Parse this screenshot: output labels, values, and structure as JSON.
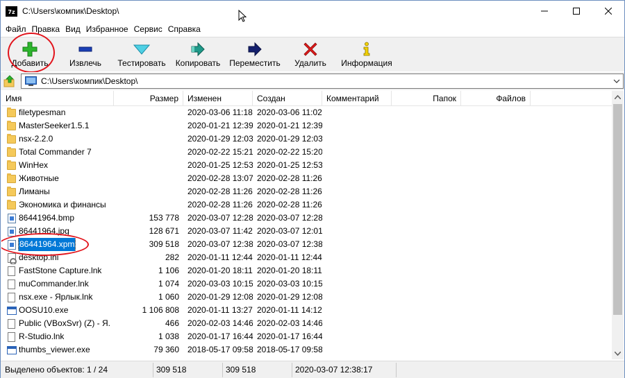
{
  "window": {
    "icon_text": "7z",
    "title": "C:\\Users\\компик\\Desktop\\"
  },
  "menu": [
    "Файл",
    "Правка",
    "Вид",
    "Избранное",
    "Сервис",
    "Справка"
  ],
  "toolbar": {
    "add": "Добавить",
    "extract": "Извлечь",
    "test": "Тестировать",
    "copy": "Копировать",
    "move": "Переместить",
    "delete": "Удалить",
    "info": "Информация"
  },
  "address": {
    "path": "C:\\Users\\компик\\Desktop\\"
  },
  "columns": {
    "name": "Имя",
    "size": "Размер",
    "modified": "Изменен",
    "created": "Создан",
    "comment": "Комментарий",
    "folders": "Папок",
    "files": "Файлов"
  },
  "files": [
    {
      "icon": "folder-icon",
      "name": "filetypesman",
      "size": "",
      "modified": "2020-03-06 11:18",
      "created": "2020-03-06 11:02"
    },
    {
      "icon": "folder-icon",
      "name": "MasterSeeker1.5.1",
      "size": "",
      "modified": "2020-01-21 12:39",
      "created": "2020-01-21 12:39"
    },
    {
      "icon": "folder-icon",
      "name": "nsx-2.2.0",
      "size": "",
      "modified": "2020-01-29 12:03",
      "created": "2020-01-29 12:03"
    },
    {
      "icon": "folder-icon",
      "name": "Total Commander 7",
      "size": "",
      "modified": "2020-02-22 15:21",
      "created": "2020-02-22 15:20"
    },
    {
      "icon": "folder-icon",
      "name": "WinHex",
      "size": "",
      "modified": "2020-01-25 12:53",
      "created": "2020-01-25 12:53"
    },
    {
      "icon": "folder-icon",
      "name": "Животные",
      "size": "",
      "modified": "2020-02-28 13:07",
      "created": "2020-02-28 11:26"
    },
    {
      "icon": "folder-icon",
      "name": "Лиманы",
      "size": "",
      "modified": "2020-02-28 11:26",
      "created": "2020-02-28 11:26"
    },
    {
      "icon": "folder-icon",
      "name": "Экономика и финансы",
      "size": "",
      "modified": "2020-02-28 11:26",
      "created": "2020-02-28 11:26"
    },
    {
      "icon": "image-file-icon",
      "name": "86441964.bmp",
      "size": "153 778",
      "modified": "2020-03-07 12:28",
      "created": "2020-03-07 12:28"
    },
    {
      "icon": "image-file-icon",
      "name": "86441964.jpg",
      "size": "128 671",
      "modified": "2020-03-07 11:42",
      "created": "2020-03-07 12:01"
    },
    {
      "icon": "image-file-icon",
      "name": "86441964.xpm",
      "size": "309 518",
      "modified": "2020-03-07 12:38",
      "created": "2020-03-07 12:38",
      "selected": true
    },
    {
      "icon": "settings-file-icon",
      "name": "desktop.ini",
      "size": "282",
      "modified": "2020-01-11 12:44",
      "created": "2020-01-11 12:44"
    },
    {
      "icon": "document-icon",
      "name": "FastStone Capture.lnk",
      "size": "1 106",
      "modified": "2020-01-20 18:11",
      "created": "2020-01-20 18:11"
    },
    {
      "icon": "document-icon",
      "name": "muCommander.lnk",
      "size": "1 074",
      "modified": "2020-03-03 10:15",
      "created": "2020-03-03 10:15"
    },
    {
      "icon": "document-icon",
      "name": "nsx.exe - Ярлык.lnk",
      "size": "1 060",
      "modified": "2020-01-29 12:08",
      "created": "2020-01-29 12:08"
    },
    {
      "icon": "exe-file-icon",
      "name": "OOSU10.exe",
      "size": "1 106 808",
      "modified": "2020-01-11 13:27",
      "created": "2020-01-11 14:12"
    },
    {
      "icon": "document-icon",
      "name": "Public (VBoxSvr) (Z) - Я...",
      "size": "466",
      "modified": "2020-02-03 14:46",
      "created": "2020-02-03 14:46"
    },
    {
      "icon": "document-icon",
      "name": "R-Studio.lnk",
      "size": "1 038",
      "modified": "2020-01-17 16:44",
      "created": "2020-01-17 16:44"
    },
    {
      "icon": "exe-file-icon",
      "name": "thumbs_viewer.exe",
      "size": "79 360",
      "modified": "2018-05-17 09:58",
      "created": "2018-05-17 09:58"
    }
  ],
  "status": {
    "selected": "Выделено объектов: 1 / 24",
    "size": "309 518",
    "packed": "309 518",
    "date": "2020-03-07 12:38:17"
  },
  "colors": {
    "selection": "#0078d7",
    "highlight_ring": "#e2141c",
    "add_green": "#2db52d",
    "extract_blue": "#1a3fb5",
    "test_cyan": "#4fd0e4",
    "copy_teal": "#1f9a8a",
    "move_navy": "#14206e",
    "delete_red": "#e01a1a",
    "info_yellow": "#f4d300"
  }
}
